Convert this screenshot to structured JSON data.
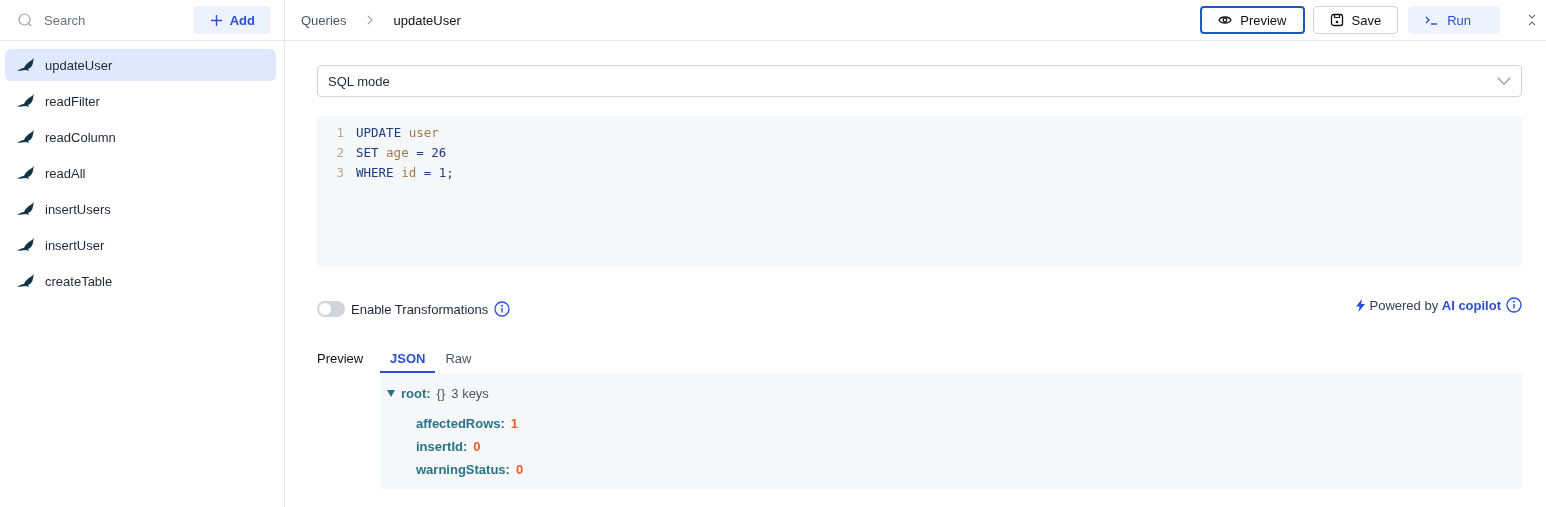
{
  "sidebar": {
    "search": {
      "placeholder": "Search"
    },
    "add_button": "Add",
    "items": [
      {
        "label": "updateUser",
        "selected": true
      },
      {
        "label": "readFilter",
        "selected": false
      },
      {
        "label": "readColumn",
        "selected": false
      },
      {
        "label": "readAll",
        "selected": false
      },
      {
        "label": "insertUsers",
        "selected": false
      },
      {
        "label": "insertUser",
        "selected": false
      },
      {
        "label": "createTable",
        "selected": false
      }
    ]
  },
  "breadcrumb": [
    "Queries",
    "updateUser"
  ],
  "toolbar": [
    {
      "label": "Preview",
      "kind": "preview"
    },
    {
      "label": "Save",
      "kind": "save"
    },
    {
      "label": "Run",
      "kind": "run"
    }
  ],
  "mode_select": {
    "value": "SQL mode"
  },
  "editor": {
    "lines": [
      {
        "number": "1",
        "tokens": [
          {
            "text": "UPDATE",
            "kind": "keyword"
          },
          {
            "text": "user",
            "kind": "identifier"
          }
        ]
      },
      {
        "number": "2",
        "tokens": [
          {
            "text": "SET",
            "kind": "keyword"
          },
          {
            "text": "age",
            "kind": "identifier"
          },
          {
            "text": "= 26",
            "kind": "keyword"
          }
        ]
      },
      {
        "number": "3",
        "tokens": [
          {
            "text": "WHERE",
            "kind": "keyword"
          },
          {
            "text": "id",
            "kind": "identifier"
          },
          {
            "text": "= 1;",
            "kind": "keyword"
          }
        ]
      }
    ]
  },
  "transformations": {
    "label": "Enable Transformations",
    "on": false
  },
  "copilot": "Powered by **AI copilot**",
  "preview": {
    "label": "Preview",
    "tabs": [
      {
        "label": "JSON",
        "selected": true
      },
      {
        "label": "Raw",
        "selected": false
      }
    ],
    "root": {
      "key": "root:",
      "type": "{}",
      "count": "3 keys",
      "expanded": true,
      "entries": [
        {
          "key": "affectedRows:",
          "value": "1"
        },
        {
          "key": "insertId:",
          "value": "0"
        },
        {
          "key": "warningStatus:",
          "value": "0"
        }
      ]
    }
  }
}
